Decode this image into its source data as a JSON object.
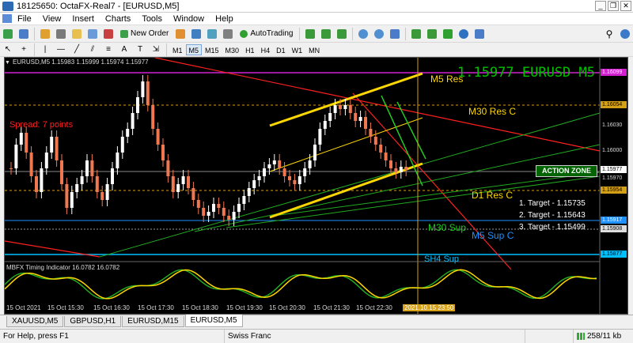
{
  "window": {
    "title": "18125650: OctaFX-Real7 - [EURUSD,M5]"
  },
  "menu": {
    "items": [
      "File",
      "View",
      "Insert",
      "Charts",
      "Tools",
      "Window",
      "Help"
    ]
  },
  "toolbar": {
    "new_order_label": "New Order",
    "autotrading_label": "AutoTrading",
    "timeframes": [
      "M1",
      "M5",
      "M15",
      "M30",
      "H1",
      "H4",
      "D1",
      "W1",
      "MN"
    ],
    "active_timeframe": "M5"
  },
  "chart": {
    "info_line": "EURUSD,M5  1.15983 1.15999 1.15974 1.15977",
    "big_price": "1.15977  EURUSD M5",
    "spread_text": "Spread: 7 points",
    "action_zone": "ACTION ZONE",
    "labels": {
      "m5_res": "M5 Res",
      "m30_res_c": "M30 Res C",
      "d1_res_c": "D1 Res C",
      "m30_sup": "M30 Sup",
      "m5_sup_c": "M5 Sup C",
      "sh4_sup": "SH4 Sup"
    },
    "targets": [
      "1. Target - 1.15735",
      "2. Target - 1.15643",
      "3. Target - 1.15499"
    ],
    "price_axis": [
      "1.16099",
      "1.16054",
      "1.16030",
      "1.16000",
      "1.15977",
      "1.15970",
      "1.15954",
      "1.15917",
      "1.15908",
      "1.15877"
    ],
    "indicator_label": "MBFX Timing Indicator 16.0782 16.0782",
    "time_axis": [
      "15 Oct 2021",
      "15 Oct 15:30",
      "15 Oct 16:30",
      "15 Oct 17:30",
      "15 Oct 18:30",
      "15 Oct 19:30",
      "15 Oct 20:30",
      "15 Oct 21:30",
      "15 Oct 22:30"
    ],
    "time_badge": "2021.10.15 23:50",
    "colors": {
      "bull": "#ffffff",
      "bear": "#f07850",
      "m5_res": "#ffd700",
      "resistance_red": "#ff2020",
      "support_green": "#22aa22",
      "support_blue": "#1e90ff"
    }
  },
  "tabs": [
    "XAUUSD,M5",
    "GBPUSD,H1",
    "EURUSD,M15",
    "EURUSD,M5"
  ],
  "active_tab": "EURUSD,M5",
  "status": {
    "help": "For Help, press F1",
    "profile": "Swiss Franc",
    "traffic": "258/11 kb"
  }
}
